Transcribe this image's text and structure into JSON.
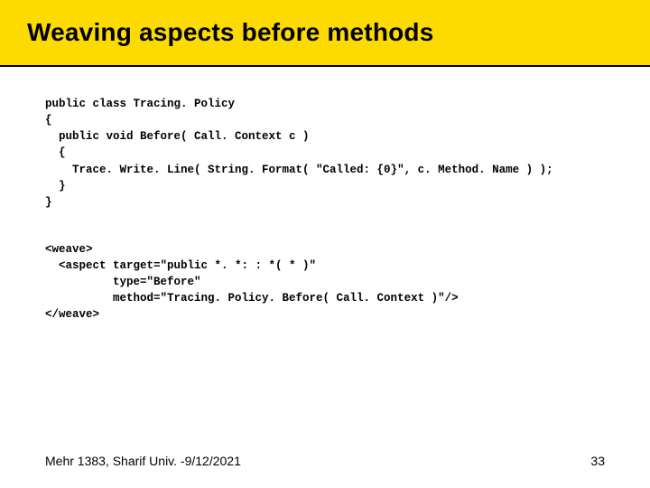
{
  "slide": {
    "title": "Weaving aspects before methods"
  },
  "code": {
    "block1": "public class Tracing. Policy\n{\n  public void Before( Call. Context c )\n  {\n    Trace. Write. Line( String. Format( \"Called: {0}\", c. Method. Name ) );\n  }\n}",
    "block2": "<weave>\n  <aspect target=\"public *. *: : *( * )\"\n          type=\"Before\"\n          method=\"Tracing. Policy. Before( Call. Context )\"/>\n</weave>"
  },
  "footer": {
    "left": "Mehr 1383,  Sharif Univ. -9/12/2021",
    "page": "33"
  }
}
